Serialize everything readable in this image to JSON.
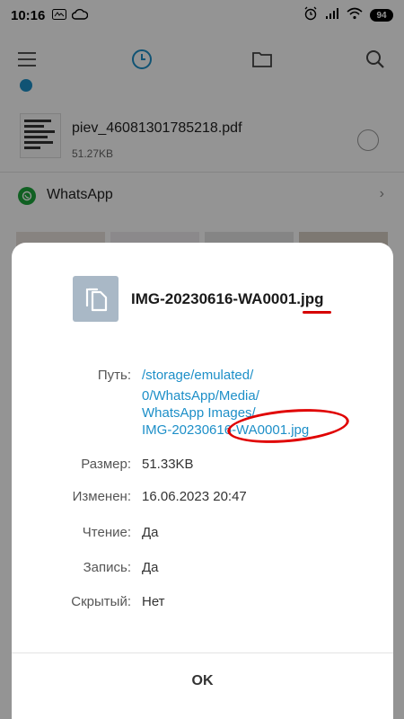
{
  "status_bar": {
    "time": "10:16",
    "battery": "94"
  },
  "file_list": {
    "items": [
      {
        "name": "piev_46081301785218.pdf",
        "size": "51.27KB"
      }
    ],
    "folder": {
      "label": "WhatsApp"
    }
  },
  "dialog": {
    "title": "IMG-20230616-WA0001.jpg",
    "properties": {
      "path_label": "Путь:",
      "path_lines": [
        "/storage/emulated/",
        "0/WhatsApp/Media/",
        "WhatsApp Images/",
        "IMG-20230616-WA0001.jpg"
      ],
      "size_label": "Размер:",
      "size_value": "51.33KB",
      "modified_label": "Изменен:",
      "modified_value": "16.06.2023 20:47",
      "read_label": "Чтение:",
      "read_value": "Да",
      "write_label": "Запись:",
      "write_value": "Да",
      "hidden_label": "Скрытый:",
      "hidden_value": "Нет"
    },
    "ok_label": "OK"
  },
  "colors": {
    "accent": "#1d8fc8",
    "annotation": "#e00000",
    "whatsapp": "#1ca63c"
  }
}
